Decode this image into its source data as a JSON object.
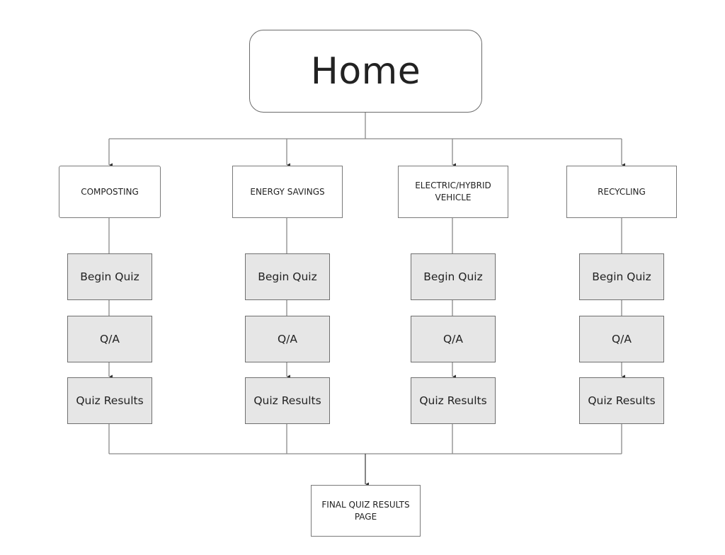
{
  "home": {
    "label": "Home"
  },
  "columns": [
    {
      "category": "COMPOSTING",
      "steps": [
        "Begin Quiz",
        "Q/A",
        "Quiz Results"
      ]
    },
    {
      "category": "ENERGY SAVINGS",
      "steps": [
        "Begin Quiz",
        "Q/A",
        "Quiz Results"
      ]
    },
    {
      "category": "ELECTRIC/HYBRID VEHICLE",
      "steps": [
        "Begin Quiz",
        "Q/A",
        "Quiz Results"
      ]
    },
    {
      "category": "RECYCLING",
      "steps": [
        "Begin Quiz",
        "Q/A",
        "Quiz Results"
      ]
    }
  ],
  "final": {
    "label": "FINAL QUIZ RESULTS PAGE"
  },
  "colors": {
    "step_fill": "#e6e6e6",
    "stroke": "#6f6f6f",
    "text": "#222222"
  }
}
